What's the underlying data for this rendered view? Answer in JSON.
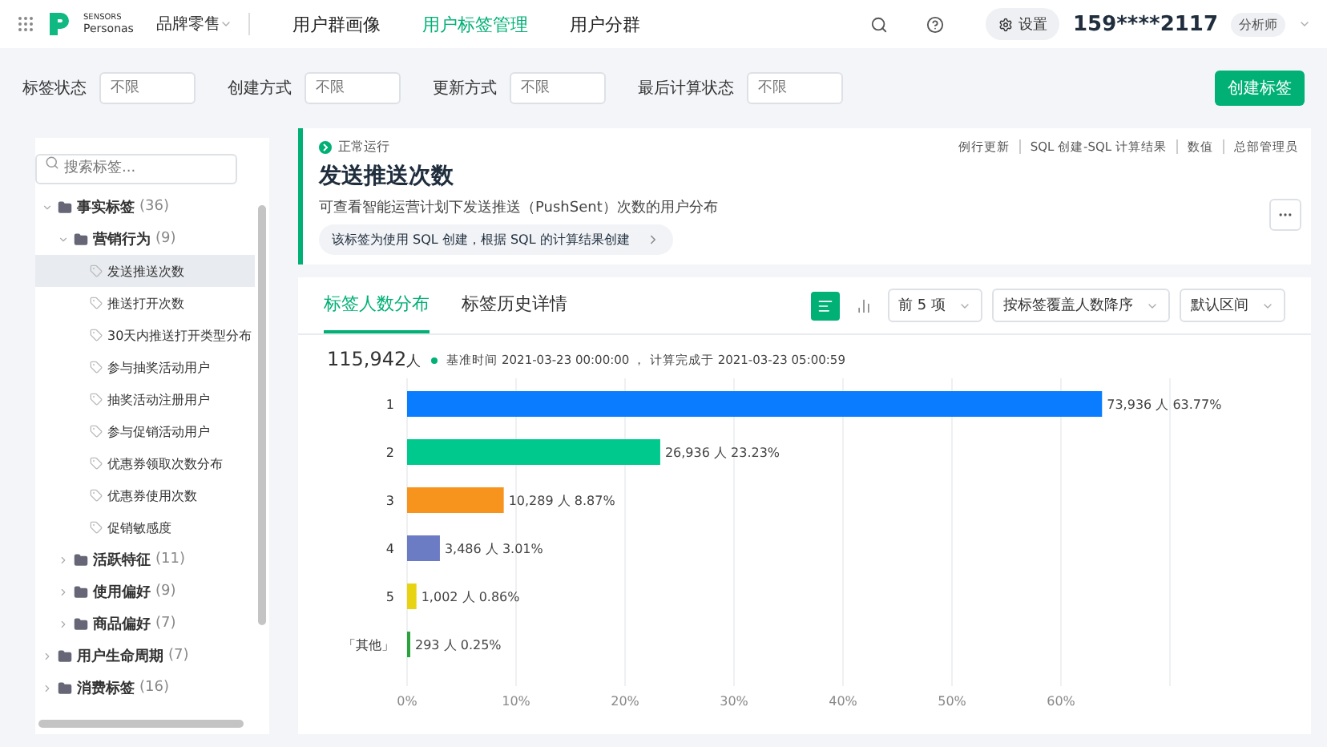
{
  "header": {
    "brand_top": "SENSORS",
    "brand_bottom": "Personas",
    "workspace": "品牌零售",
    "nav": [
      {
        "label": "用户群画像",
        "selected": false
      },
      {
        "label": "用户标签管理",
        "selected": true
      },
      {
        "label": "用户分群",
        "selected": false
      }
    ],
    "settings": "设置",
    "user": "159****2117",
    "role": "分析师"
  },
  "filters": [
    {
      "label": "标签状态",
      "placeholder": "不限"
    },
    {
      "label": "创建方式",
      "placeholder": "不限"
    },
    {
      "label": "更新方式",
      "placeholder": "不限"
    },
    {
      "label": "最后计算状态",
      "placeholder": "不限"
    }
  ],
  "create_button": "创建标签",
  "sidebar": {
    "search": {
      "placeholder": "搜索标签..."
    },
    "tree": [
      {
        "label": "事实标签",
        "count": "(36)",
        "kind": "folder",
        "expanded": true,
        "selected": false,
        "children": [
          {
            "label": "营销行为",
            "count": "(9)",
            "kind": "folder",
            "expanded": true,
            "selected": false,
            "children": [
              {
                "label": "发送推送次数",
                "kind": "tag",
                "selected": true
              },
              {
                "label": "推送打开次数",
                "kind": "tag",
                "selected": false
              },
              {
                "label": "30天内推送打开类型分布",
                "kind": "tag",
                "selected": false
              },
              {
                "label": "参与抽奖活动用户",
                "kind": "tag",
                "selected": false
              },
              {
                "label": "抽奖活动注册用户",
                "kind": "tag",
                "selected": false
              },
              {
                "label": "参与促销活动用户",
                "kind": "tag",
                "selected": false
              },
              {
                "label": "优惠券领取次数分布",
                "kind": "tag",
                "selected": false
              },
              {
                "label": "优惠券使用次数",
                "kind": "tag",
                "selected": false
              },
              {
                "label": "促销敏感度",
                "kind": "tag",
                "selected": false
              }
            ]
          },
          {
            "label": "活跃特征",
            "count": "(11)",
            "kind": "folder",
            "expanded": false,
            "selected": false
          },
          {
            "label": "使用偏好",
            "count": "(9)",
            "kind": "folder",
            "expanded": false,
            "selected": false
          },
          {
            "label": "商品偏好",
            "count": "(7)",
            "kind": "folder",
            "expanded": false,
            "selected": false
          }
        ]
      },
      {
        "label": "用户生命周期",
        "count": "(7)",
        "kind": "folder",
        "expanded": false,
        "selected": false
      },
      {
        "label": "消费标签",
        "count": "(16)",
        "kind": "folder",
        "expanded": false,
        "selected": false
      }
    ]
  },
  "tag": {
    "status": "正常运行",
    "meta": [
      "例行更新",
      "SQL 创建-SQL 计算结果",
      "数值",
      "总部管理员"
    ],
    "title": "发送推送次数",
    "description": "可查看智能运营计划下发送推送（PushSent）次数的用户分布",
    "note": "该标签为使用 SQL 创建，根据 SQL 的计算结果创建"
  },
  "tabs": [
    {
      "label": "标签人数分布",
      "selected": true
    },
    {
      "label": "标签历史详情",
      "selected": false
    }
  ],
  "view_toggle": [
    {
      "kind": "bar",
      "selected": true
    },
    {
      "kind": "column",
      "selected": false
    }
  ],
  "selects": [
    "前 5 项",
    "按标签覆盖人数降序",
    "默认区间"
  ],
  "summary": {
    "total": "115,942",
    "unit": "人",
    "info": "基准时间 2021-03-23 00:00:00 ， 计算完成于 2021-03-23 05:00:59"
  },
  "chart_data": {
    "type": "bar",
    "orientation": "horizontal",
    "categories": [
      "1",
      "2",
      "3",
      "4",
      "5",
      "「其他」"
    ],
    "values": [
      63.77,
      23.23,
      8.87,
      3.01,
      0.86,
      0.25
    ],
    "xlim": [
      0,
      70
    ],
    "grid": true,
    "colors": [
      "#0a7cff",
      "#00c98d",
      "#f7941d",
      "#6b7bc4",
      "#e8d313",
      "#2aa33b"
    ],
    "value_labels": [
      "73,936 人 63.77%",
      "26,936 人 23.23%",
      "10,289 人 8.87%",
      "3,486 人 3.01%",
      "1,002 人 0.86%",
      "293 人 0.25%"
    ],
    "xticks": [
      {
        "value": 0,
        "label": "0%"
      },
      {
        "value": 10,
        "label": "10%"
      },
      {
        "value": 20,
        "label": "20%"
      },
      {
        "value": 30,
        "label": "30%"
      },
      {
        "value": 40,
        "label": "40%"
      },
      {
        "value": 50,
        "label": "50%"
      },
      {
        "value": 60,
        "label": "60%"
      }
    ]
  }
}
